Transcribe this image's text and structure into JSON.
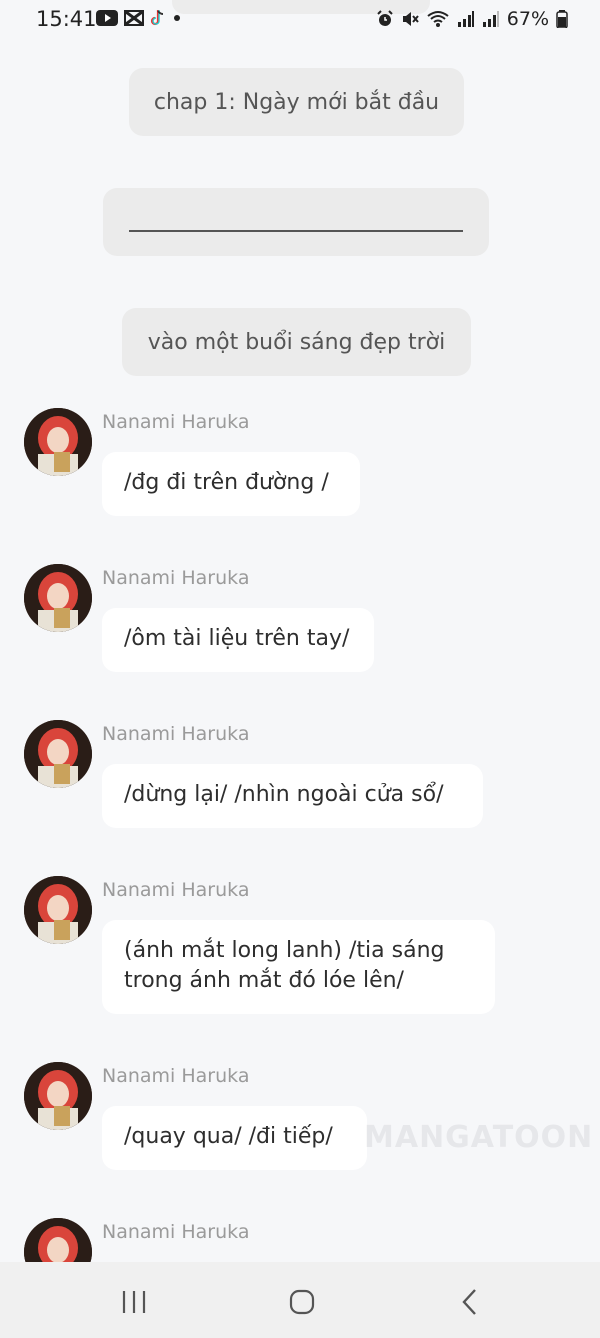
{
  "status": {
    "time": "15:41",
    "battery": "67%",
    "left_icons": [
      "youtube-icon",
      "capcut-icon",
      "tiktok-icon",
      "dot-icon"
    ],
    "right_icons": [
      "alarm-icon",
      "mute-icon",
      "wifi-icon",
      "signal-icon",
      "signal-icon",
      "battery-icon"
    ]
  },
  "narration": [
    {
      "text": "chap 1: Ngày mới bắt đầu"
    },
    {
      "text": ""
    },
    {
      "text": "vào một buổi sáng đẹp trời"
    }
  ],
  "messages": [
    {
      "speaker": "Nanami Haruka",
      "text": "/đg đi trên đường /"
    },
    {
      "speaker": "Nanami Haruka",
      "text": "/ôm tài liệu trên tay/"
    },
    {
      "speaker": "Nanami Haruka",
      "text": "/dừng lại/ /nhìn ngoài cửa sổ/"
    },
    {
      "speaker": "Nanami Haruka",
      "text": "(ánh mắt long lanh) /tia sáng trong ánh mắt đó lóe lên/"
    },
    {
      "speaker": "Nanami Haruka",
      "text": "/quay qua/ /đi tiếp/"
    },
    {
      "speaker": "Nanami Haruka",
      "text": ""
    }
  ],
  "watermark": "MANGATOON",
  "navbar": {
    "buttons": [
      "recent-apps-icon",
      "home-icon",
      "back-icon"
    ]
  }
}
